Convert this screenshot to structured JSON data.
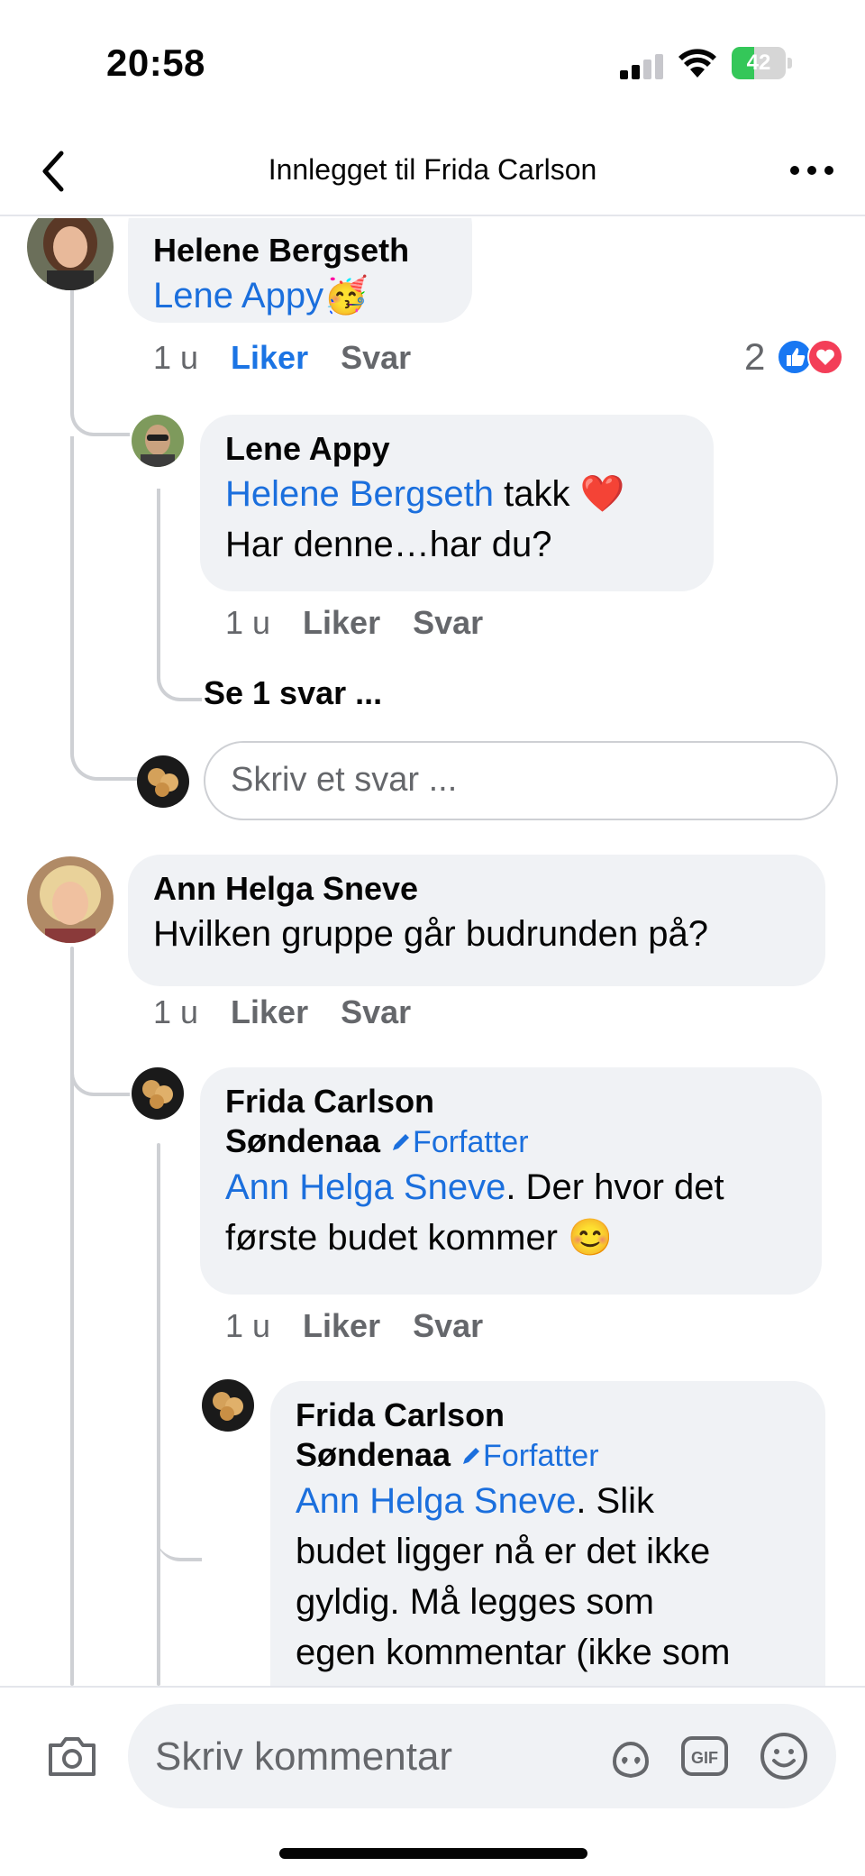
{
  "status_bar": {
    "time": "20:58",
    "battery_percent": "42",
    "battery_level": 0.42,
    "signal_bars_active": 2,
    "signal_bars_total": 4
  },
  "nav": {
    "title": "Innlegget til Frida Carlson"
  },
  "comments": [
    {
      "author": "Helene Bergseth",
      "mention": "Lene Appy",
      "text_after": "🥳",
      "time": "1 u",
      "like_label": "Liker",
      "reply_label": "Svar",
      "reaction_count": "2",
      "reactions": [
        "like-icon",
        "love-icon"
      ]
    },
    {
      "author": "Lene Appy",
      "mention": "Helene Bergseth",
      "text_after": " takk ❤️",
      "line2": "Har denne…har du?",
      "time": "1 u",
      "like_label": "Liker",
      "reply_label": "Svar"
    },
    {
      "author": "Ann Helga Sneve",
      "text": "Hvilken gruppe går budrunden på?",
      "time": "1 u",
      "like_label": "Liker",
      "reply_label": "Svar"
    },
    {
      "author_line1": "Frida Carlson",
      "author_line2": "Søndenaa",
      "badge": "Forfatter",
      "mention": "Ann Helga Sneve",
      "text_after": ". Der hvor det",
      "line2": "første budet kommer 😊",
      "time": "1 u",
      "like_label": "Liker",
      "reply_label": "Svar"
    },
    {
      "author_line1": "Frida Carlson",
      "author_line2": "Søndenaa",
      "badge": "Forfatter",
      "mention": "Ann Helga Sneve",
      "text_after": ". Slik",
      "line2": "budet ligger nå er det ikke",
      "line3": "gyldig. Må legges som",
      "line4": "egen kommentar (ikke som"
    }
  ],
  "see_replies": "Se 1 svar ...",
  "reply_input_placeholder": "Skriv et svar ...",
  "composer": {
    "placeholder": "Skriv kommentar",
    "gif_label": "GIF"
  },
  "colors": {
    "link": "#1b6fdd",
    "bubble": "#f0f2f5",
    "meta": "#65676b",
    "liked": "#1b74e4",
    "battery_green": "#34c759"
  }
}
